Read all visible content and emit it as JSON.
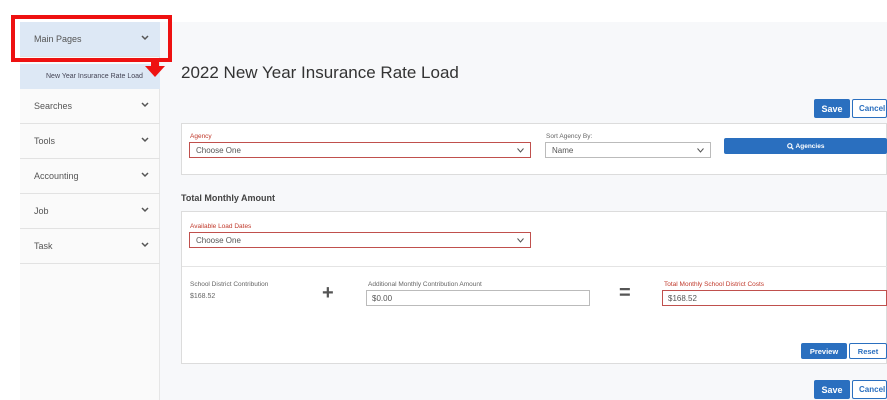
{
  "sidebar": {
    "items": [
      {
        "label": "Main Pages"
      },
      {
        "label": "Searches"
      },
      {
        "label": "Tools"
      },
      {
        "label": "Accounting"
      },
      {
        "label": "Job"
      },
      {
        "label": "Task"
      }
    ],
    "sub_item": {
      "label": "New Year Insurance Rate Load"
    }
  },
  "page": {
    "title": "2022 New Year Insurance Rate Load"
  },
  "top_actions": {
    "save_label": "Save",
    "cancel_label": "Cancel"
  },
  "agency_card": {
    "agency_label": "Agency",
    "agency_value": "Choose One",
    "sort_label": "Sort Agency By:",
    "sort_value": "Name",
    "agencies_button": "Agencies"
  },
  "total_section": {
    "heading": "Total Monthly Amount",
    "load_dates_label": "Available Load Dates",
    "load_dates_value": "Choose One",
    "school_contribution_label": "School District Contribution",
    "school_contribution_value": "$168.52",
    "additional_label": "Additional Monthly Contribution Amount",
    "additional_value": "$0.00",
    "total_label": "Total Monthly School District Costs",
    "total_value": "$168.52",
    "plus": "+",
    "equals": "=",
    "preview_label": "Preview",
    "reset_label": "Reset"
  },
  "bottom_actions": {
    "save_label": "Save",
    "cancel_label": "Cancel"
  },
  "colors": {
    "primary": "#2a6fbf",
    "highlight": "#ee1111",
    "required": "#c0392b",
    "sidebar_active": "#dde8f5"
  }
}
